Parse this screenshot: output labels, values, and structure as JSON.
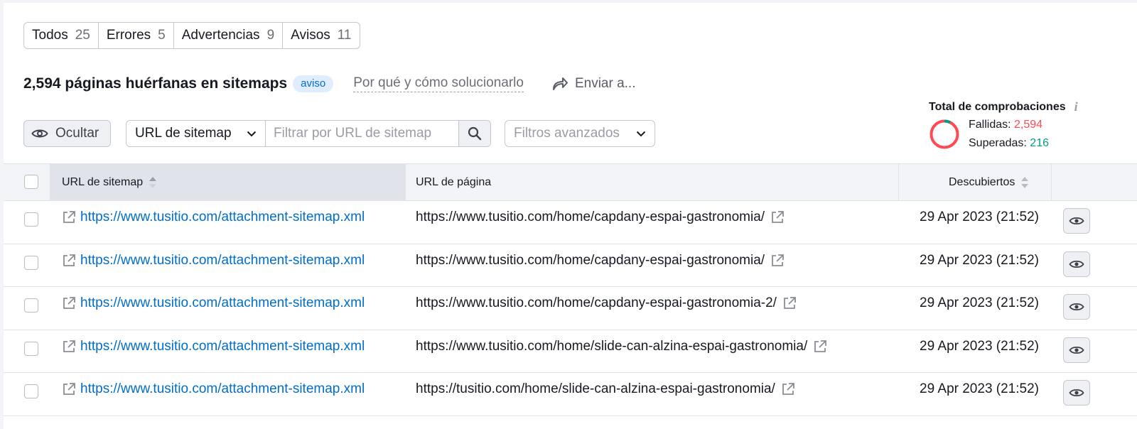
{
  "tabs": [
    {
      "label": "Todos",
      "count": "25"
    },
    {
      "label": "Errores",
      "count": "5"
    },
    {
      "label": "Advertencias",
      "count": "9"
    },
    {
      "label": "Avisos",
      "count": "11"
    }
  ],
  "issue": {
    "title": "2,594 páginas huérfanas en sitemaps",
    "badge": "aviso",
    "howto_link": "Por qué y cómo solucionarlo",
    "send_label": "Enviar a..."
  },
  "toolbar": {
    "hide_label": "Ocultar",
    "filter_select": "URL de sitemap",
    "filter_placeholder": "Filtrar por URL de sitemap",
    "advanced_filters": "Filtros avanzados"
  },
  "checks": {
    "title": "Total de comprobaciones",
    "failed_label": "Fallidas:",
    "failed_value": "2,594",
    "passed_label": "Superadas:",
    "passed_value": "216",
    "colors": {
      "failed": "#ff4953",
      "passed": "#009f81"
    }
  },
  "table": {
    "headers": {
      "sitemap_url": "URL de sitemap",
      "page_url": "URL de página",
      "discovered": "Descubiertos"
    },
    "rows": [
      {
        "sitemap": "https://www.tusitio.com/attachment-sitemap.xml",
        "page": "https://www.tusitio.com/home/capdany-espai-gastronomia/",
        "date": "29 Apr 2023 (21:52)"
      },
      {
        "sitemap": "https://www.tusitio.com/attachment-sitemap.xml",
        "page": "https://www.tusitio.com/home/capdany-espai-gastronomia/",
        "date": "29 Apr 2023 (21:52)"
      },
      {
        "sitemap": "https://www.tusitio.com/attachment-sitemap.xml",
        "page": "https://www.tusitio.com/home/capdany-espai-gastronomia-2/",
        "date": "29 Apr 2023 (21:52)"
      },
      {
        "sitemap": "https://www.tusitio.com/attachment-sitemap.xml",
        "page": "https://www.tusitio.com/home/slide-can-alzina-espai-gastronomia/",
        "date": "29 Apr 2023 (21:52)"
      },
      {
        "sitemap": "https://www.tusitio.com/attachment-sitemap.xml",
        "page": "https://tusitio.com/home/slide-can-alzina-espai-gastronomia/",
        "date": "29 Apr 2023 (21:52)"
      }
    ]
  },
  "colors": {
    "link": "#006dca",
    "badge_bg": "#e0ecff"
  }
}
